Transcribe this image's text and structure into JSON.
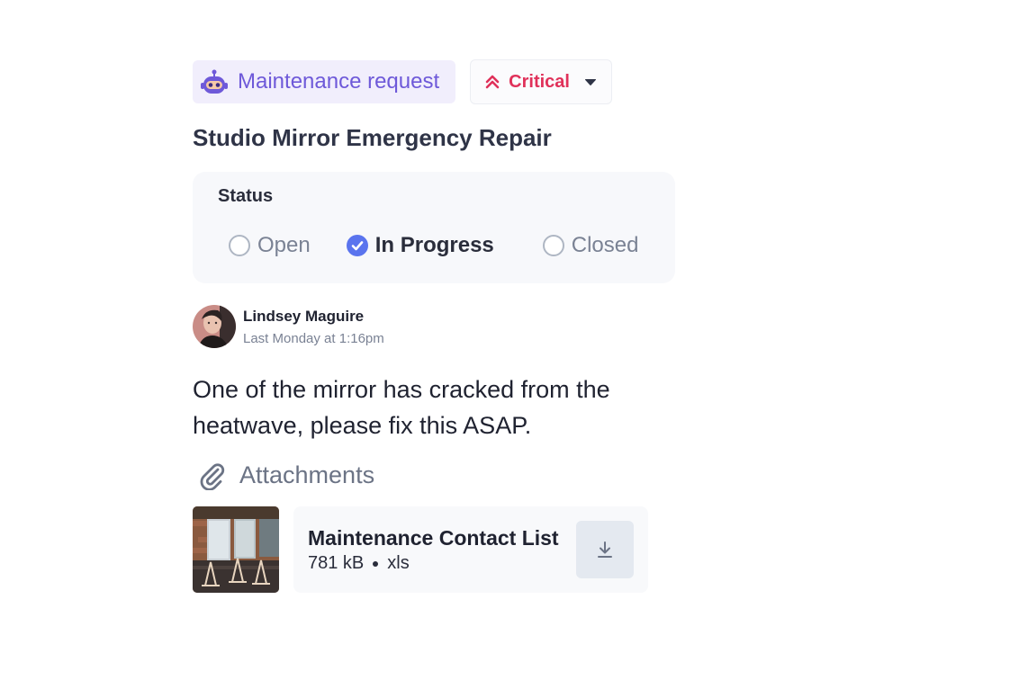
{
  "request": {
    "type_label": "Maintenance request",
    "type_icon": "robot-icon",
    "priority_label": "Critical",
    "priority_icon": "chevrons-up-icon",
    "title": "Studio Mirror Emergency Repair"
  },
  "status": {
    "label": "Status",
    "options": [
      {
        "label": "Open",
        "checked": false
      },
      {
        "label": "In Progress",
        "checked": true
      },
      {
        "label": "Closed",
        "checked": false
      }
    ]
  },
  "author": {
    "name": "Lindsey Maguire",
    "time": "Last Monday at 1:16pm"
  },
  "message": "One of the mirror has cracked from the heatwave, please fix this ASAP.",
  "attachments": {
    "heading": "Attachments",
    "file": {
      "name": "Maintenance Contact List",
      "size": "781 kB",
      "ext": "xls"
    }
  },
  "colors": {
    "accent": "#5a74ee",
    "tag_purple": "#6e59d9",
    "critical": "#e0315a"
  }
}
